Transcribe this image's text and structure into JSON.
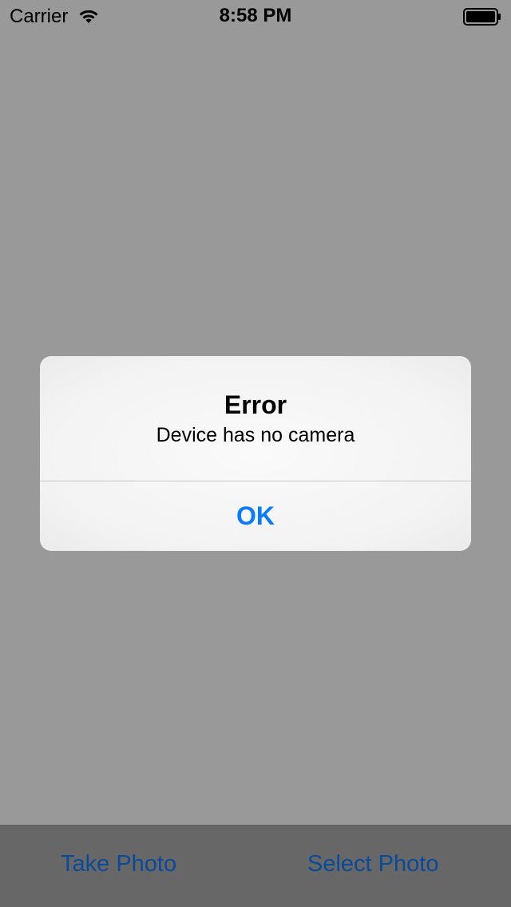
{
  "status_bar": {
    "carrier": "Carrier",
    "time": "8:58 PM",
    "wifi_icon": "wifi-icon",
    "battery_icon": "battery-icon"
  },
  "alert": {
    "title": "Error",
    "message": "Device has no camera",
    "ok_label": "OK"
  },
  "toolbar": {
    "take_photo_label": "Take Photo",
    "select_photo_label": "Select Photo"
  },
  "colors": {
    "dim_background": "#999999",
    "toolbar_background": "#676767",
    "toolbar_tint": "#0b4a99",
    "alert_button": "#0a7bff"
  }
}
